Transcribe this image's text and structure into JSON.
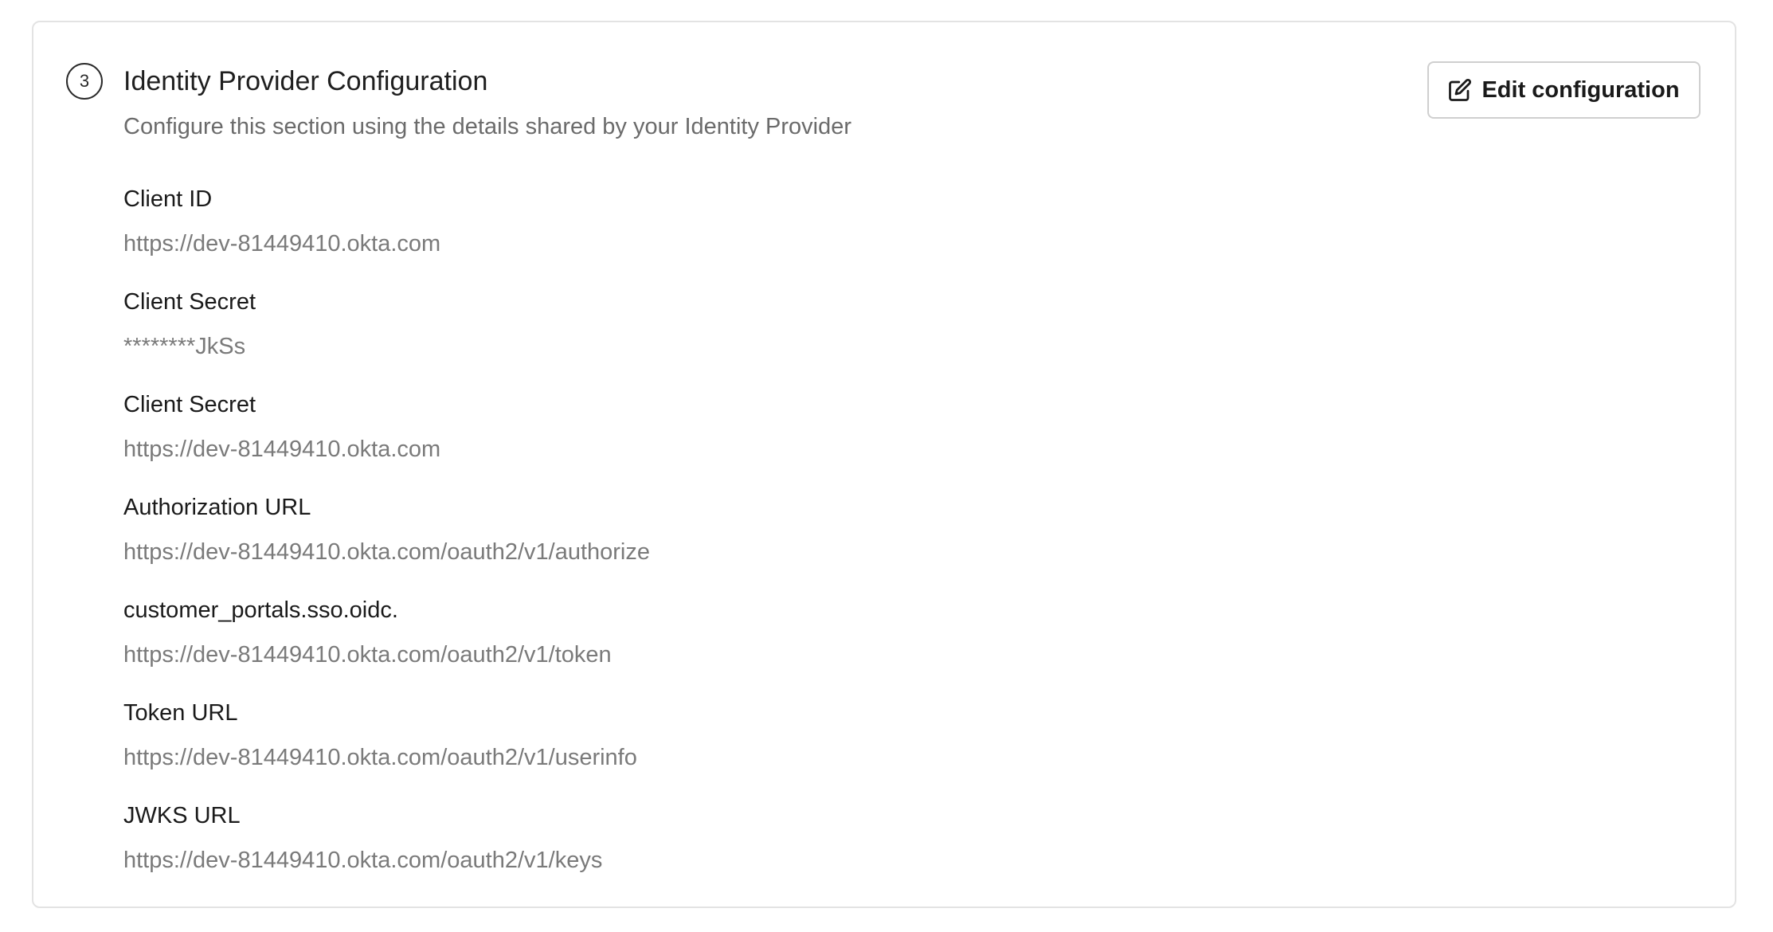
{
  "section": {
    "step_number": "3",
    "title": "Identity Provider Configuration",
    "subtitle": "Configure this section using the details shared by your Identity Provider",
    "edit_button_label": "Edit configuration",
    "edit_icon": "edit-pencil-square-icon"
  },
  "fields": [
    {
      "label": "Client ID",
      "value": "https://dev-81449410.okta.com"
    },
    {
      "label": "Client Secret",
      "value": "********JkSs"
    },
    {
      "label": "Client Secret",
      "value": "https://dev-81449410.okta.com"
    },
    {
      "label": "Authorization URL",
      "value": "https://dev-81449410.okta.com/oauth2/v1/authorize"
    },
    {
      "label": "customer_portals.sso.oidc.",
      "value": "https://dev-81449410.okta.com/oauth2/v1/token"
    },
    {
      "label": "Token URL",
      "value": "https://dev-81449410.okta.com/oauth2/v1/userinfo"
    },
    {
      "label": "JWKS URL",
      "value": "https://dev-81449410.okta.com/oauth2/v1/keys"
    }
  ]
}
